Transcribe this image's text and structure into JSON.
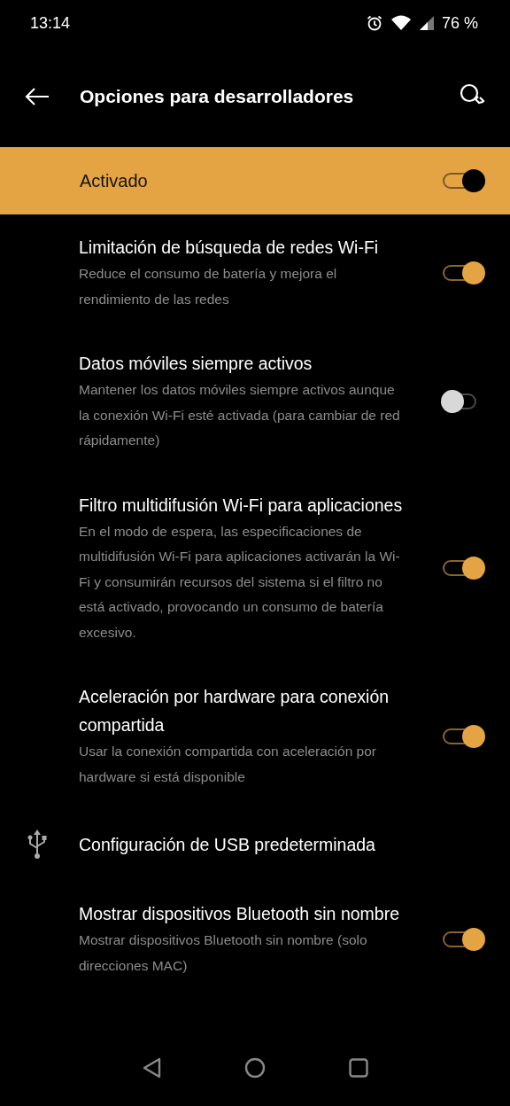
{
  "status_bar": {
    "time": "13:14",
    "battery": "76 %"
  },
  "toolbar": {
    "title": "Opciones para desarrolladores"
  },
  "master": {
    "label": "Activado",
    "on": true
  },
  "items": [
    {
      "kind": "switch",
      "title": "Limitación de búsqueda de redes Wi-Fi",
      "summary": "Reduce el consumo de batería y mejora el rendimiento de las redes",
      "on": true
    },
    {
      "kind": "switch",
      "title": "Datos móviles siempre activos",
      "summary": "Mantener los datos móviles siempre activos aunque la conexión Wi-Fi esté activada (para cambiar de red rápidamente)",
      "on": false
    },
    {
      "kind": "switch",
      "title": "Filtro multidifusión Wi-Fi para aplicaciones",
      "summary": "En el modo de espera, las especificaciones de multidifusión Wi-Fi para aplicaciones activarán la Wi-Fi y consumirán recursos del sistema si el filtro no está activado, provocando un consumo de batería excesivo.",
      "on": true
    },
    {
      "kind": "switch",
      "title": "Aceleración por hardware para conexión compartida",
      "summary": "Usar la conexión compartida con aceleración por hardware si está disponible",
      "on": true
    },
    {
      "kind": "usb",
      "title": "Configuración de USB predeterminada"
    },
    {
      "kind": "switch",
      "title": "Mostrar dispositivos Bluetooth sin nombre",
      "summary": "Mostrar dispositivos Bluetooth sin nombre (solo direcciones MAC)",
      "on": true
    }
  ]
}
